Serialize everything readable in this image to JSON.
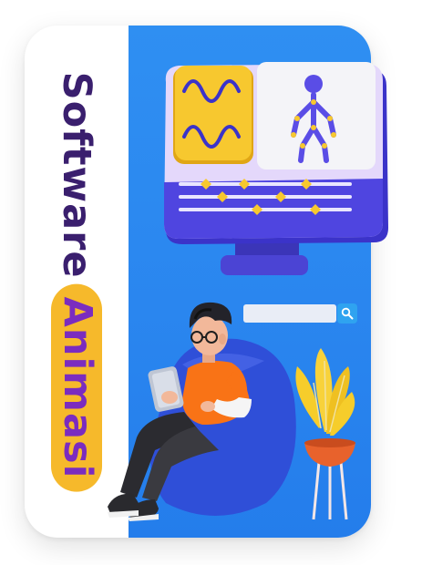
{
  "title": {
    "word1": "Software",
    "word2": "Animasi"
  },
  "colors": {
    "panel_blue": "#2a86ef",
    "title_dark": "#3a1f6e",
    "title_purple": "#7b2cbf",
    "pill_yellow": "#f6b92b",
    "monitor_purple": "#4b3fd6",
    "shirt_orange": "#f97316",
    "beanbag_blue": "#2f4fd8",
    "plant_yellow": "#f8d23a"
  },
  "icons": [
    "waveform-icon",
    "skeleton-rig-icon",
    "timeline-icon",
    "search-icon"
  ]
}
